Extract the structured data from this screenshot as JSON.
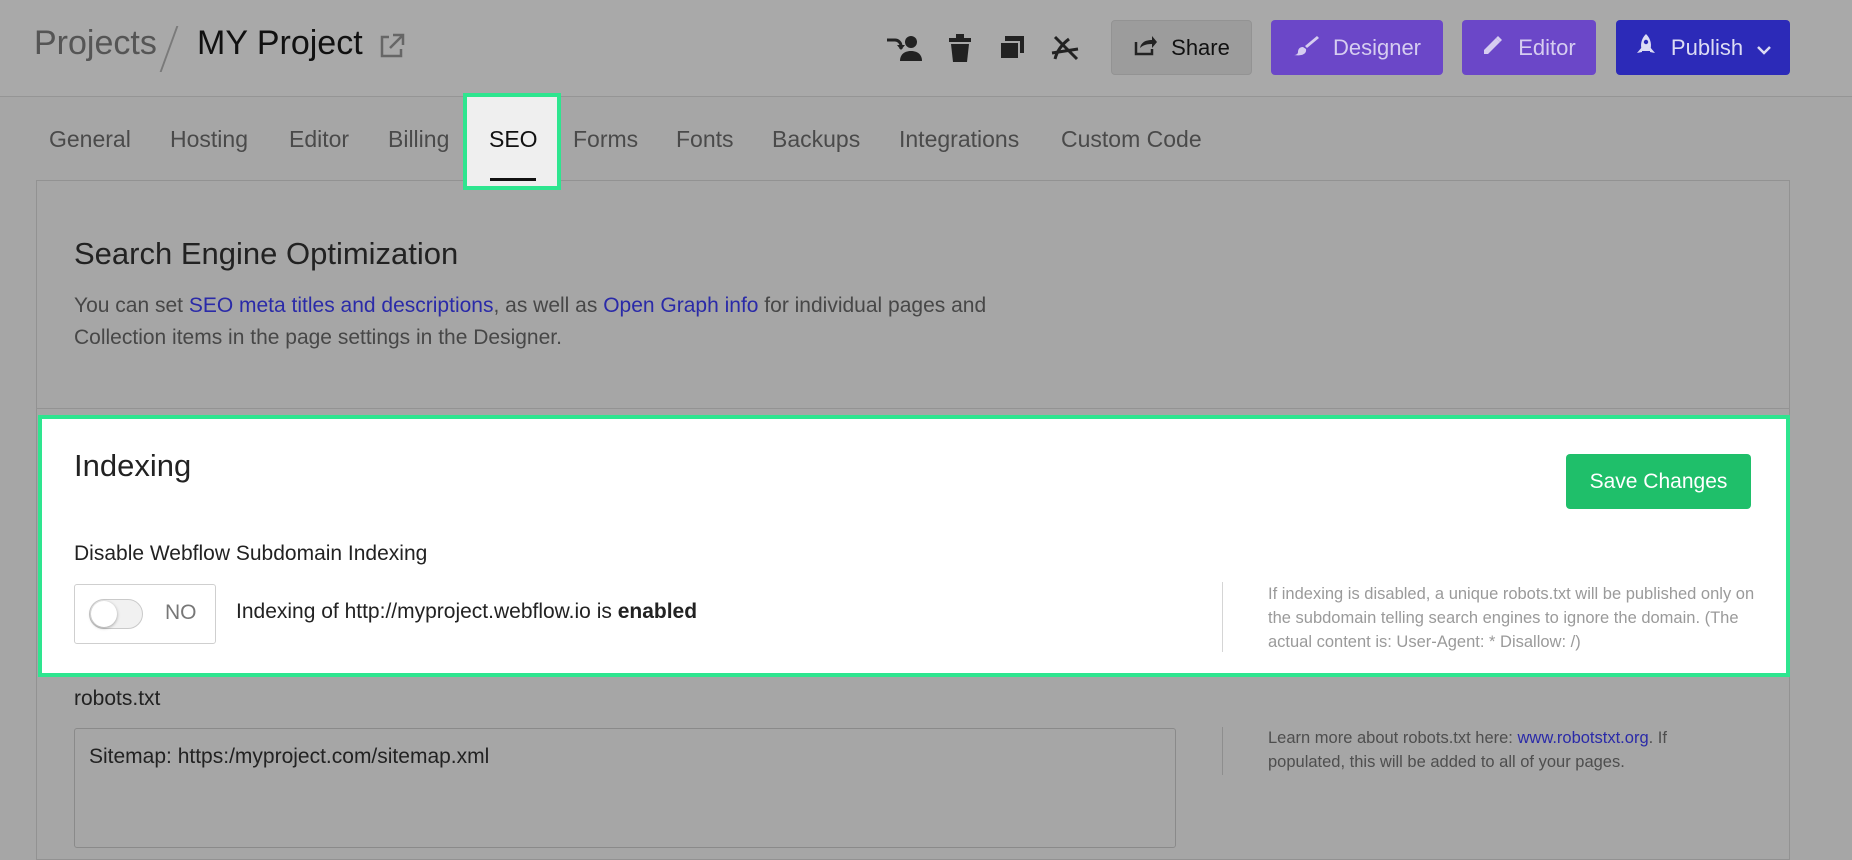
{
  "header": {
    "breadcrumb_root": "Projects",
    "project_name": "MY Project",
    "icons": [
      "transfer-user-icon",
      "trash-icon",
      "duplicate-icon",
      "unpublish-icon"
    ],
    "share_label": "Share",
    "designer_label": "Designer",
    "editor_label": "Editor",
    "publish_label": "Publish"
  },
  "tabs": [
    {
      "label": "General"
    },
    {
      "label": "Hosting"
    },
    {
      "label": "Editor"
    },
    {
      "label": "Billing"
    },
    {
      "label": "SEO",
      "active": true
    },
    {
      "label": "Forms"
    },
    {
      "label": "Fonts"
    },
    {
      "label": "Backups"
    },
    {
      "label": "Integrations"
    },
    {
      "label": "Custom Code"
    }
  ],
  "seo": {
    "title": "Search Engine Optimization",
    "desc_pre": "You can set ",
    "link1": "SEO meta titles and descriptions",
    "desc_mid": ", as well as ",
    "link2": "Open Graph info",
    "desc_post": " for individual pages and Collection items in the page settings in the Designer."
  },
  "indexing": {
    "title": "Indexing",
    "save_label": "Save Changes",
    "option_label": "Disable Webflow Subdomain Indexing",
    "toggle_value": "NO",
    "status_pre": "Indexing of http://myproject.webflow.io is ",
    "status_value": "enabled",
    "help": "If indexing is disabled, a unique robots.txt will be published only on the subdomain telling search engines to ignore the domain. (The actual content is: User-Agent: * Disallow: /)"
  },
  "robots": {
    "label": "robots.txt",
    "value": "Sitemap: https:/myproject.com/sitemap.xml",
    "help_pre": "Learn more about robots.txt here: ",
    "help_link": "www.robotstxt.org",
    "help_post": ". If populated, this will be added to all of your pages."
  },
  "colors": {
    "designer": "#6b47c8",
    "publish": "#2c2ab8",
    "save": "#1fbf6a",
    "highlight": "#2ee58f",
    "link": "#2a2aa8"
  }
}
